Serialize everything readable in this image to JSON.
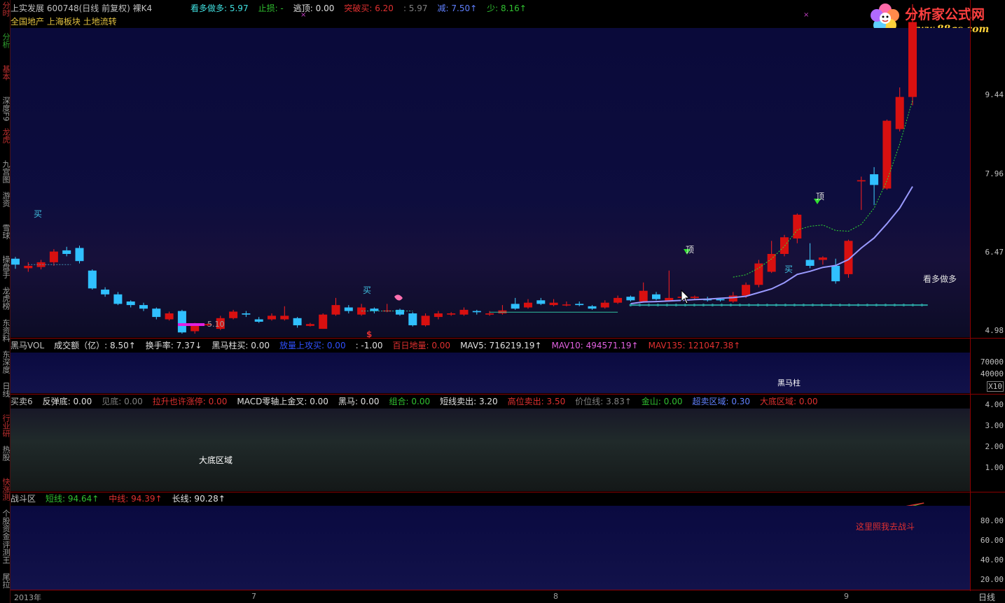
{
  "sidebar": {
    "items": [
      {
        "label": "分时",
        "color": "#c03030"
      },
      {
        "label": "分析",
        "color": "#30a030"
      },
      {
        "label": "基本",
        "color": "#c03030"
      },
      {
        "label": "深度F9",
        "color": "#a0a0a0"
      },
      {
        "label": "龙虎",
        "color": "#c03030"
      },
      {
        "label": "九宫图",
        "color": "#a0a0a0"
      },
      {
        "label": "游资",
        "color": "#a0a0a0"
      },
      {
        "label": "雪球",
        "color": "#a0a0a0"
      },
      {
        "label": "操盘手",
        "color": "#a0a0a0"
      },
      {
        "label": "龙虎榜",
        "color": "#a0a0a0"
      },
      {
        "label": "东资料",
        "color": "#a0a0a0"
      },
      {
        "label": "东深度",
        "color": "#a0a0a0"
      },
      {
        "label": "日线",
        "color": "#a0a0a0"
      },
      {
        "label": "行业研",
        "color": "#c03030"
      },
      {
        "label": "热股",
        "color": "#a0a0a0"
      },
      {
        "label": "快涨测",
        "color": "#c03030"
      },
      {
        "label": "个股资金",
        "color": "#a0a0a0"
      },
      {
        "label": "评测王",
        "color": "#a0a0a0"
      },
      {
        "label": "尾拉",
        "color": "#a0a0a0"
      }
    ]
  },
  "main": {
    "title": "上实发展 600748(日线 前复权) 裸K4",
    "indicators": [
      {
        "text": "看多做多: 5.97",
        "color": "#40e0e0"
      },
      {
        "text": "止损: -",
        "color": "#30c030"
      },
      {
        "text": "逃顶: 0.00",
        "color": "#e0e0e0"
      },
      {
        "text": "突破买: 6.20",
        "color": "#e03030"
      },
      {
        "text": ": 5.97",
        "color": "#808080"
      },
      {
        "text": "减: 7.50↑",
        "color": "#6080ff"
      },
      {
        "text": "少: 8.16↑",
        "color": "#30c030"
      }
    ],
    "tags": "全国地产 上海板块 土地流转",
    "price_ticks": [
      "9.44",
      "7.96",
      "6.47",
      "4.98"
    ],
    "labels": {
      "buy1": "买",
      "buy2": "买",
      "buy3": "买",
      "top1": "顶",
      "top2": "顶",
      "low_price": "5.10",
      "trend_label": "看多做多",
      "dollar": "$"
    }
  },
  "watermark": {
    "title": "分析家公式网",
    "url": "www.88gs.com"
  },
  "vol_panel": {
    "header": [
      {
        "text": "黑马VOL",
        "color": "#c0c0c0"
      },
      {
        "text": "成交额（亿）: 8.50↑",
        "color": "#e0e0e0"
      },
      {
        "text": "换手率: 7.37↓",
        "color": "#e0e0e0"
      },
      {
        "text": "黑马柱买: 0.00",
        "color": "#e0e0e0"
      },
      {
        "text": "放量上攻买: 0.00",
        "color": "#3050ff"
      },
      {
        "text": ": -1.00",
        "color": "#e0e0e0"
      },
      {
        "text": "百日地量: 0.00",
        "color": "#e03030"
      },
      {
        "text": "MAV5: 716219.19↑",
        "color": "#e0e0e0"
      },
      {
        "text": "MAV10: 494571.19↑",
        "color": "#e060e0"
      },
      {
        "text": "MAV135: 121047.38↑",
        "color": "#e03030"
      }
    ],
    "ticks": [
      "70000",
      "40000",
      "X10"
    ],
    "label": "黑马柱"
  },
  "trade_panel": {
    "header": [
      {
        "text": "买卖6",
        "color": "#c0c0c0"
      },
      {
        "text": "反弹底: 0.00",
        "color": "#e0e0e0"
      },
      {
        "text": "见底: 0.00",
        "color": "#808080"
      },
      {
        "text": "拉升也许涨停: 0.00",
        "color": "#e03030"
      },
      {
        "text": "MACD零轴上金叉: 0.00",
        "color": "#e0e0e0"
      },
      {
        "text": "黑马: 0.00",
        "color": "#e0e0e0"
      },
      {
        "text": "组合: 0.00",
        "color": "#30c030"
      },
      {
        "text": "短线卖出: 3.20",
        "color": "#e0e0e0"
      },
      {
        "text": "高位卖出: 3.50",
        "color": "#e03030"
      },
      {
        "text": "价位线: 3.83↑",
        "color": "#808080"
      },
      {
        "text": "金山: 0.00",
        "color": "#30c030"
      },
      {
        "text": "超卖区域: 0.30",
        "color": "#6080ff"
      },
      {
        "text": "大底区域: 0.00",
        "color": "#e03030"
      }
    ],
    "ticks": [
      "4.00",
      "3.00",
      "2.00",
      "1.00"
    ],
    "label": "大底区域"
  },
  "battle_panel": {
    "header": [
      {
        "text": "战斗区",
        "color": "#c0c0c0"
      },
      {
        "text": "短线: 94.64↑",
        "color": "#30c030"
      },
      {
        "text": "中线: 94.39↑",
        "color": "#e03030"
      },
      {
        "text": "长线: 90.28↑",
        "color": "#e0e0e0"
      }
    ],
    "ticks": [
      "80.00",
      "60.00",
      "40.00",
      "20.00"
    ],
    "label": "这里照我去战斗"
  },
  "xaxis": {
    "labels": [
      "2013年",
      "7",
      "8",
      "9"
    ],
    "period": "日线"
  },
  "chart_data": {
    "type": "candlestick",
    "title": "上实发展 600748(日线 前复权) 裸K4",
    "ylim": [
      4.9,
      10.1
    ],
    "candles": [
      [
        6.22,
        6.12,
        6.25,
        6.05
      ],
      [
        6.06,
        6.1,
        6.16,
        6.0
      ],
      [
        6.08,
        6.16,
        6.2,
        6.04
      ],
      [
        6.16,
        6.34,
        6.38,
        6.1
      ],
      [
        6.36,
        6.3,
        6.42,
        6.26
      ],
      [
        6.4,
        6.18,
        6.44,
        6.14
      ],
      [
        6.02,
        5.72,
        6.04,
        5.7
      ],
      [
        5.7,
        5.62,
        5.74,
        5.58
      ],
      [
        5.62,
        5.46,
        5.66,
        5.44
      ],
      [
        5.5,
        5.44,
        5.52,
        5.4
      ],
      [
        5.44,
        5.38,
        5.48,
        5.34
      ],
      [
        5.38,
        5.24,
        5.4,
        5.2
      ],
      [
        5.2,
        5.3,
        5.33,
        5.18
      ],
      [
        5.34,
        4.98,
        5.36,
        4.96
      ],
      [
        5.0,
        5.12,
        5.14,
        4.96
      ],
      [
        5.1,
        5.12,
        5.13,
        5.09
      ],
      [
        5.04,
        5.22,
        5.26,
        5.02
      ],
      [
        5.22,
        5.33,
        5.36,
        5.2
      ],
      [
        5.3,
        5.28,
        5.34,
        5.24
      ],
      [
        5.2,
        5.16,
        5.24,
        5.14
      ],
      [
        5.2,
        5.26,
        5.3,
        5.18
      ],
      [
        5.2,
        5.26,
        5.42,
        5.18
      ],
      [
        5.22,
        5.1,
        5.24,
        5.06
      ],
      [
        5.09,
        5.12,
        5.14,
        5.08
      ],
      [
        5.04,
        5.28,
        5.3,
        5.04
      ],
      [
        5.28,
        5.44,
        5.56,
        5.26
      ],
      [
        5.4,
        5.34,
        5.44,
        5.3
      ],
      [
        5.28,
        5.4,
        5.46,
        5.26
      ],
      [
        5.38,
        5.34,
        5.4,
        5.3
      ],
      [
        5.34,
        5.35,
        5.46,
        5.32
      ],
      [
        5.36,
        5.28,
        5.38,
        5.26
      ],
      [
        5.3,
        5.1,
        5.32,
        5.08
      ],
      [
        5.1,
        5.26,
        5.3,
        5.08
      ],
      [
        5.24,
        5.3,
        5.34,
        5.2
      ],
      [
        5.28,
        5.3,
        5.32,
        5.26
      ],
      [
        5.28,
        5.36,
        5.4,
        5.26
      ],
      [
        5.34,
        5.32,
        5.36,
        5.28
      ],
      [
        5.28,
        5.3,
        5.34,
        5.26
      ],
      [
        5.3,
        5.35,
        5.44,
        5.28
      ],
      [
        5.46,
        5.38,
        5.56,
        5.36
      ],
      [
        5.4,
        5.48,
        5.54,
        5.38
      ],
      [
        5.52,
        5.46,
        5.56,
        5.44
      ],
      [
        5.44,
        5.48,
        5.54,
        5.42
      ],
      [
        5.44,
        5.45,
        5.5,
        5.42
      ],
      [
        5.46,
        5.44,
        5.5,
        5.42
      ],
      [
        5.42,
        5.38,
        5.44,
        5.36
      ],
      [
        5.4,
        5.48,
        5.52,
        5.38
      ],
      [
        5.48,
        5.56,
        5.6,
        5.46
      ],
      [
        5.58,
        5.52,
        5.6,
        5.5
      ],
      [
        5.5,
        5.68,
        5.82,
        5.48
      ],
      [
        5.62,
        5.54,
        5.66,
        5.52
      ],
      [
        5.5,
        5.56,
        6.02,
        5.5
      ],
      [
        5.56,
        5.58,
        5.64,
        5.52
      ],
      [
        5.56,
        5.58,
        5.6,
        5.54
      ],
      [
        5.54,
        5.52,
        5.58,
        5.5
      ],
      [
        5.54,
        5.52,
        5.56,
        5.5
      ],
      [
        5.5,
        5.6,
        5.66,
        5.48
      ],
      [
        5.6,
        5.78,
        5.82,
        5.56
      ],
      [
        5.78,
        6.14,
        6.2,
        5.74
      ],
      [
        6.0,
        6.3,
        6.52,
        5.98
      ],
      [
        6.3,
        6.58,
        6.62,
        6.26
      ],
      [
        6.56,
        6.96,
        6.98,
        6.48
      ],
      [
        6.2,
        6.1,
        6.48,
        6.06
      ],
      [
        6.2,
        6.24,
        6.26,
        6.12
      ],
      [
        6.1,
        5.84,
        6.22,
        5.8
      ],
      [
        5.96,
        6.52,
        6.54,
        5.9
      ],
      [
        7.52,
        7.54,
        7.6,
        7.04
      ],
      [
        7.64,
        7.46,
        7.76,
        7.12
      ],
      [
        7.4,
        8.54,
        8.56,
        7.38
      ],
      [
        8.4,
        8.94,
        9.1,
        8.36
      ],
      [
        8.94,
        10.2,
        10.5,
        8.8
      ]
    ]
  }
}
